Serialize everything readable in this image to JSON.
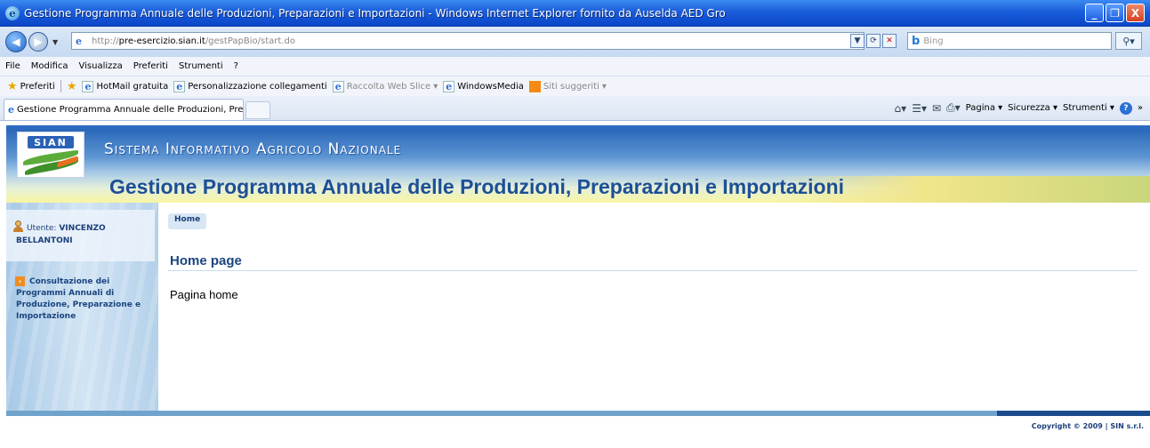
{
  "window": {
    "title": "Gestione Programma Annuale delle Produzioni, Preparazioni e Importazioni - Windows Internet Explorer fornito da Auselda AED Gro",
    "minimize": "_",
    "restore": "❐",
    "close": "X"
  },
  "address_bar": {
    "url_prefix": "http://",
    "url_domain": "pre-esercizio.sian.it",
    "url_path": "/gestPapBio/start.do",
    "search_placeholder": "Bing"
  },
  "menu": {
    "items": [
      "File",
      "Modifica",
      "Visualizza",
      "Preferiti",
      "Strumenti",
      "?"
    ]
  },
  "favorites_bar": {
    "favorites_label": "Preferiti",
    "items": [
      {
        "label": "HotMail gratuita",
        "dim": false
      },
      {
        "label": "Personalizzazione collegamenti",
        "dim": false
      },
      {
        "label": "Raccolta Web Slice",
        "dim": true
      },
      {
        "label": "WindowsMedia",
        "dim": false
      },
      {
        "label": "Siti suggeriti",
        "dim": true
      }
    ]
  },
  "tabs": {
    "active_tab": "Gestione Programma Annuale delle Produzioni, Prepar..."
  },
  "command_bar": {
    "pagina": "Pagina",
    "sicurezza": "Sicurezza",
    "strumenti": "Strumenti"
  },
  "site": {
    "logo_text": "SIAN",
    "header": "Sistema Informativo Agricolo Nazionale",
    "app_title": "Gestione Programma Annuale delle Produzioni, Preparazioni e Importazioni"
  },
  "sidebar": {
    "user_label": "Utente:",
    "user_name": "VINCENZO BELLANTONI",
    "link": "Consultazione dei Programmi Annuali di Produzione, Preparazione e Importazione"
  },
  "main": {
    "breadcrumb": "Home",
    "heading": "Home page",
    "body": "Pagina home"
  },
  "footer": {
    "copyright": "Copyright © 2009 | SIN s.r.l."
  }
}
